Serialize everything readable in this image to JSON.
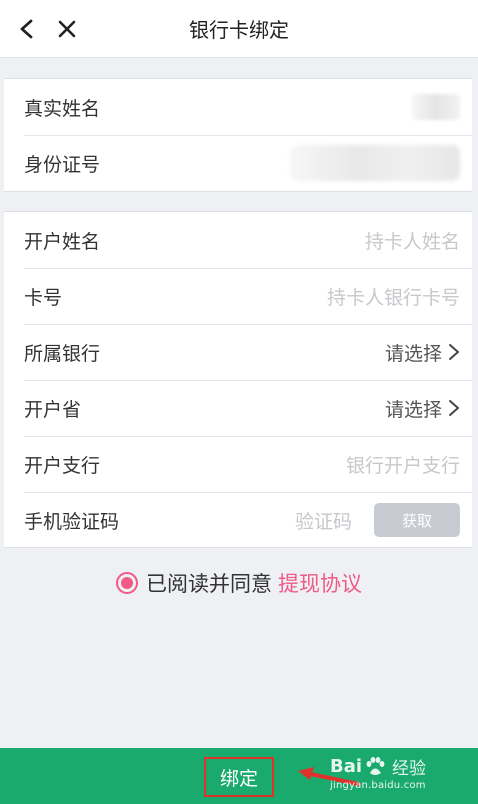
{
  "header": {
    "title": "银行卡绑定",
    "back_icon": "chevron-left-icon",
    "close_icon": "close-icon"
  },
  "identity": {
    "rows": [
      {
        "label": "真实姓名"
      },
      {
        "label": "身份证号"
      }
    ]
  },
  "form": {
    "rows": [
      {
        "label": "开户姓名",
        "placeholder": "持卡人姓名"
      },
      {
        "label": "卡号",
        "placeholder": "持卡人银行卡号"
      },
      {
        "label": "所属银行",
        "value": "请选择"
      },
      {
        "label": "开户省",
        "value": "请选择"
      },
      {
        "label": "开户支行",
        "placeholder": "银行开户支行"
      },
      {
        "label": "手机验证码",
        "placeholder": "验证码",
        "button": "获取"
      }
    ]
  },
  "agreement": {
    "text": "已阅读并同意",
    "link": "提现协议",
    "checked": true
  },
  "footer": {
    "bind_label": "绑定",
    "watermark_brand_left": "Bai",
    "watermark_brand_right": "经验",
    "watermark_url": "jingyan.baidu.com"
  },
  "colors": {
    "accent": "#ef5a86",
    "primary": "#1aaa6e",
    "highlight": "#e0322c"
  }
}
